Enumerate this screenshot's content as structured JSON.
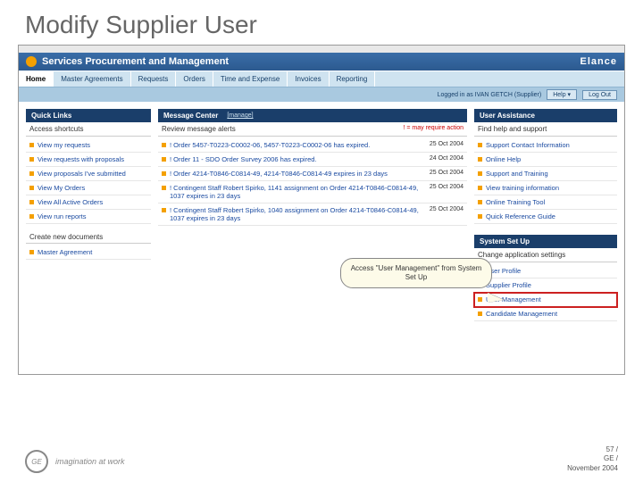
{
  "slide": {
    "title": "Modify Supplier User"
  },
  "brand": {
    "title": "Services Procurement and Management",
    "vendor": "Elance"
  },
  "nav": {
    "tabs": [
      "Home",
      "Master Agreements",
      "Requests",
      "Orders",
      "Time and Expense",
      "Invoices",
      "Reporting"
    ],
    "active_index": 0
  },
  "userbar": {
    "logged_in": "Logged in as IVAN GETCH (Supplier)",
    "help": "Help ▾",
    "logout": "Log Out"
  },
  "quicklinks": {
    "header": "Quick Links",
    "sub": "Access shortcuts",
    "items": [
      "View my requests",
      "View requests with proposals",
      "View proposals I've submitted",
      "View My Orders",
      "View All Active Orders",
      "View run reports"
    ],
    "create_sub": "Create new documents",
    "create_items": [
      "Master Agreement"
    ]
  },
  "messages": {
    "header": "Message Center",
    "manage": "[manage]",
    "sub": "Review message alerts",
    "req_note": "! = may require action",
    "items": [
      {
        "text": "! Order 5457-T0223-C0002-06, 5457-T0223-C0002-06 has expired.",
        "date": "25 Oct 2004"
      },
      {
        "text": "! Order 11 - SDO Order Survey 2006 has expired.",
        "date": "24 Oct 2004"
      },
      {
        "text": "! Order 4214-T0846-C0814-49, 4214-T0846-C0814-49 expires in 23 days",
        "date": "25 Oct 2004"
      },
      {
        "text": "! Contingent Staff Robert Spirko, 1141 assignment on Order 4214-T0846-C0814-49, 1037 expires in 23 days",
        "date": "25 Oct 2004"
      },
      {
        "text": "! Contingent Staff Robert Spirko, 1040 assignment on Order 4214-T0846-C0814-49, 1037 expires in 23 days",
        "date": "25 Oct 2004"
      }
    ]
  },
  "assist": {
    "header": "User Assistance",
    "sub": "Find help and support",
    "items": [
      "Support Contact Information",
      "Online Help",
      "Support and Training",
      "View training information",
      "Online Training Tool",
      "Quick Reference Guide"
    ]
  },
  "setup": {
    "header": "System Set Up",
    "sub": "Change application settings",
    "items": [
      "User Profile",
      "Supplier Profile",
      "User Management",
      "Candidate Management"
    ],
    "highlight_index": 2
  },
  "callout": {
    "text": "Access \"User Management\" from System Set Up"
  },
  "footer": {
    "tagline": "imagination at work",
    "page": "57 /",
    "org": "GE /",
    "date": "November 2004"
  }
}
